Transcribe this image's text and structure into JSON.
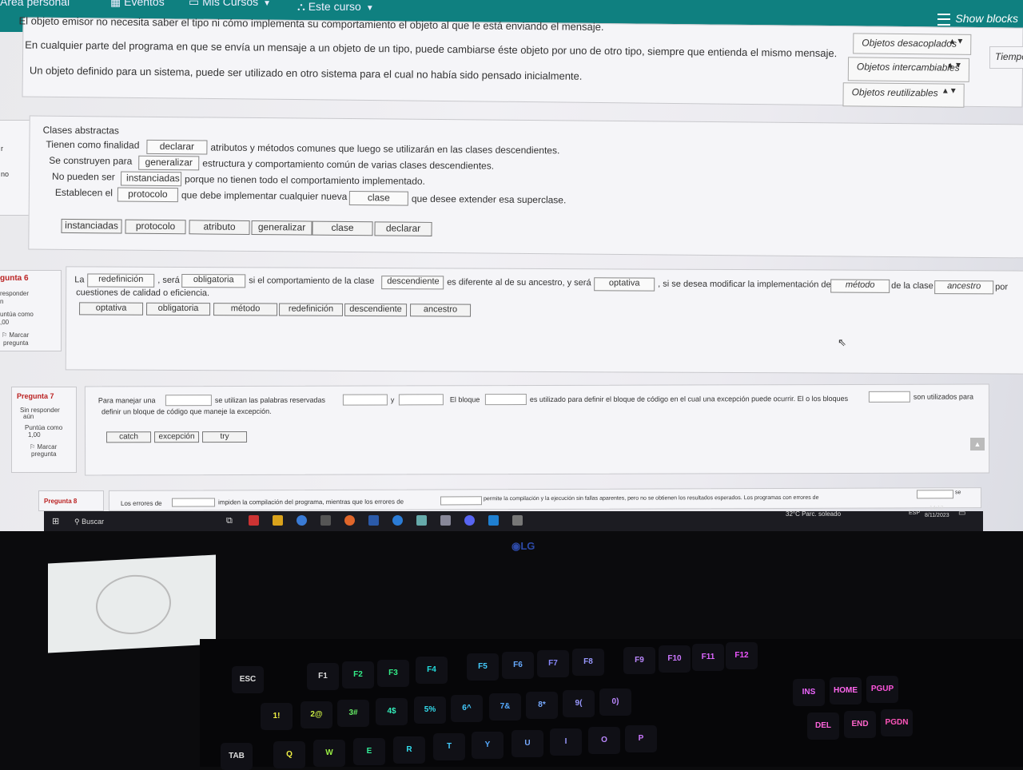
{
  "nav": {
    "area_personal": "Área personal",
    "eventos": "Eventos",
    "mis_cursos": "Mis Cursos",
    "este_curso": "Este curso",
    "show_blocks": "Show blocks"
  },
  "q_top": {
    "lines": [
      "El objeto emisor no necesita saber el tipo ni cómo implementa su comportamiento el objeto al que le está enviando el mensaje.",
      "En cualquier parte del programa en que se envía un mensaje a un objeto de un tipo, puede cambiarse éste objeto por uno de otro tipo, siempre que entienda el mismo mensaje.",
      "Un objeto definido para un sistema, puede ser utilizado en otro sistema para el cual no había sido pensado inicialmente."
    ],
    "selects": [
      "Objetos desacoplados",
      "Objetos intercambiables",
      "Objetos reutilizables"
    ],
    "right_cut": "Tiempo"
  },
  "q5": {
    "title": "Clases abstractas",
    "l1_a": "Tienen como finalidad",
    "l1_drop": "declarar",
    "l1_b": "atributos y métodos comunes que luego se utilizarán en las clases descendientes.",
    "l2_a": "Se construyen para",
    "l2_drop": "generalizar",
    "l2_b": "estructura y comportamiento común de varias clases descendientes.",
    "l3_a": "No pueden ser",
    "l3_drop": "instanciadas",
    "l3_b": "porque no tienen todo el comportamiento implementado.",
    "l4_a": "Establecen el",
    "l4_drop": "protocolo",
    "l4_b": "que debe implementar cualquier nueva",
    "l4_drop2": "clase",
    "l4_c": "que desee extender esa superclase.",
    "chips": [
      "instanciadas",
      "protocolo",
      "atributo",
      "generalizar",
      "clase",
      "declarar"
    ],
    "left_r": "r",
    "left_no": "no"
  },
  "q6": {
    "label": "gunta 6",
    "sin": "responder",
    "sin2": "n",
    "puntua": "untúa como",
    "puntua2": ",00",
    "marcar": "Marcar",
    "marcar2": "pregunta",
    "t_la": "La",
    "d1": "redefinición",
    "t_sera": ", será",
    "d2": "obligatoria",
    "t_si": "si el comportamiento de la clase",
    "d3": "descendiente",
    "t_es": "es diferente al de su ancestro, y será",
    "d4": "optativa",
    "t_si2": ", si se desea modificar la implementación del",
    "d5": "método",
    "t_de": "de la clase",
    "d6": "ancestro",
    "t_por": "por",
    "line2": "cuestiones de calidad o eficiencia.",
    "chips": [
      "optativa",
      "obligatoria",
      "método",
      "redefinición",
      "descendiente",
      "ancestro"
    ]
  },
  "q7": {
    "label": "Pregunta 7",
    "sin": "Sin responder",
    "sin2": "aún",
    "puntua": "Puntúa como",
    "puntua2": "1,00",
    "marcar": "Marcar",
    "marcar2": "pregunta",
    "t1": "Para manejar una",
    "t2": "se utilizan las palabras reservadas",
    "t3": "y",
    "t4": "El bloque",
    "t5": "es utilizado para definir el bloque de código en el cual una excepción puede ocurrir. El o los bloques",
    "t6": "son utilizados para",
    "line2": "definir un bloque de código que maneje la excepción.",
    "chips": [
      "catch",
      "excepción",
      "try"
    ]
  },
  "q8": {
    "label": "Pregunta 8",
    "t1": "Los errores de",
    "t2": "impiden la compilación del programa, mientras que los errores de",
    "t3": "permite la compilación y la ejecución sin fallas aparentes, pero no se obtienen los resultados esperados. Los programas con errores de",
    "t4": "se"
  },
  "taskbar": {
    "search": "Buscar",
    "weather": "32°C  Parc. soleado",
    "lang": "ESP",
    "time": "14:12",
    "date": "8/11/2023"
  },
  "monitor_brand": "LG",
  "keys": {
    "esc": "ESC",
    "f1": "F1",
    "f2": "F2",
    "f3": "F3",
    "f4": "F4",
    "f5": "F5",
    "f6": "F6",
    "f7": "F7",
    "f8": "F8",
    "f9": "F9",
    "f10": "F10",
    "f11": "F11",
    "f12": "F12",
    "k1": "1!",
    "k2": "2@",
    "k3": "3#",
    "k4": "4$",
    "k5": "5%",
    "k6": "6^",
    "k7": "7&",
    "k8": "8*",
    "k9": "9(",
    "k0": "0)",
    "tab": "TAB",
    "q": "Q",
    "w": "W",
    "e": "E",
    "r": "R",
    "t": "T",
    "y": "Y",
    "u": "U",
    "i": "I",
    "o": "O",
    "p": "P",
    "del": "DEL",
    "end": "END",
    "pgdn": "PGDN",
    "ins": "INS",
    "home": "HOME",
    "pgup": "PGUP"
  }
}
